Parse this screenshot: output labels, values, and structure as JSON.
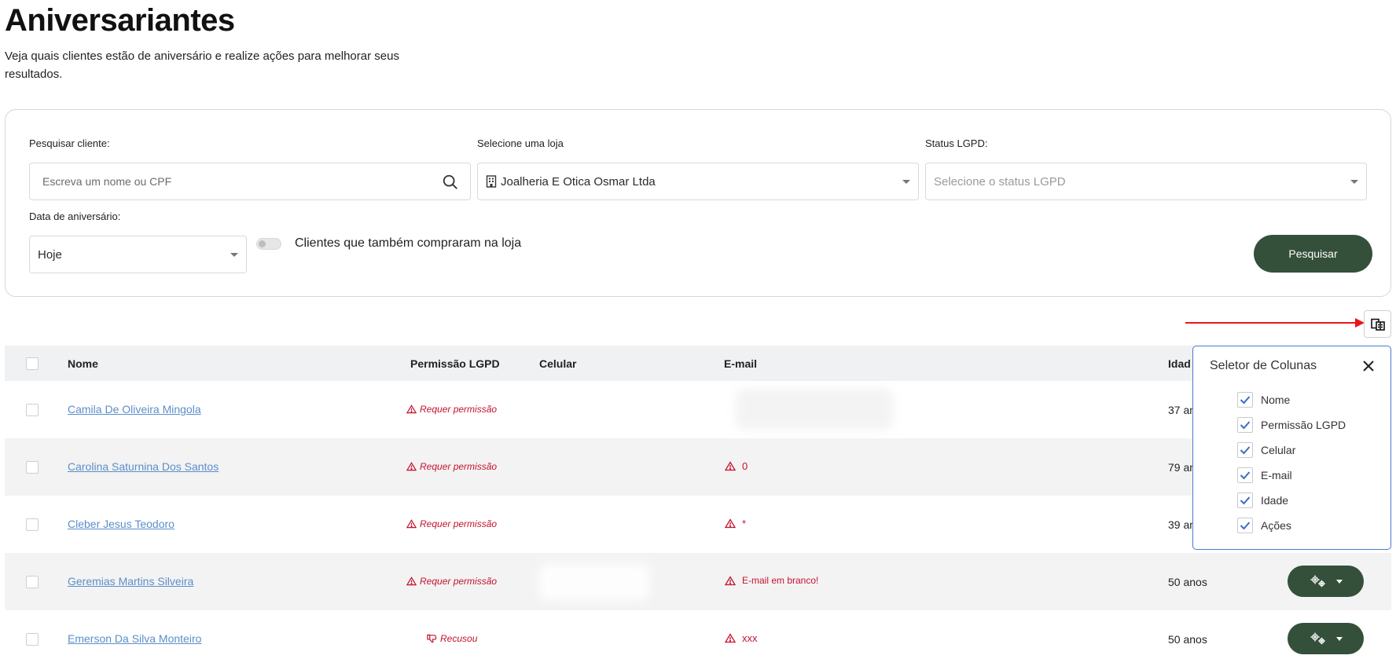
{
  "header": {
    "title": "Aniversariantes",
    "subtitle": "Veja quais clientes estão de aniversário e realize ações para melhorar seus resultados."
  },
  "filters": {
    "search_label": "Pesquisar cliente:",
    "search_placeholder": "Escreva um nome ou CPF",
    "store_label": "Selecione uma loja",
    "store_value": "Joalheria E Otica Osmar Ltda",
    "lgpd_label": "Status LGPD:",
    "lgpd_placeholder": "Selecione o status LGPD",
    "birthday_label": "Data de aniversário:",
    "birthday_value": "Hoje",
    "toggle_label": "Clientes que também compraram na loja",
    "toggle_on": false,
    "search_button": "Pesquisar"
  },
  "table": {
    "headers": {
      "name": "Nome",
      "lgpd": "Permissão LGPD",
      "phone": "Celular",
      "email": "E-mail",
      "age": "Idad"
    },
    "rows": [
      {
        "name": "Camila De Oliveira Mingola",
        "lgpd": "Requer permissão",
        "lgpd_type": "warning",
        "email": "",
        "age": "37 an",
        "actions": false
      },
      {
        "name": "Carolina Saturnina Dos Santos",
        "lgpd": "Requer permissão",
        "lgpd_type": "warning",
        "email": "0",
        "age": "79 an",
        "actions": false
      },
      {
        "name": "Cleber Jesus Teodoro",
        "lgpd": "Requer permissão",
        "lgpd_type": "warning",
        "email": "*",
        "age": "39 an",
        "actions": false
      },
      {
        "name": "Geremias Martins Silveira",
        "lgpd": "Requer permissão",
        "lgpd_type": "warning",
        "email": "E-mail em branco!",
        "age": "50 anos",
        "actions": true
      },
      {
        "name": "Emerson Da Silva Monteiro",
        "lgpd": "Recusou",
        "lgpd_type": "refused",
        "email": "xxx",
        "age": "50 anos",
        "actions": true
      }
    ]
  },
  "column_selector": {
    "title": "Seletor de Colunas",
    "options": [
      {
        "label": "Nome",
        "checked": true
      },
      {
        "label": "Permissão LGPD",
        "checked": true
      },
      {
        "label": "Celular",
        "checked": true
      },
      {
        "label": "E-mail",
        "checked": true
      },
      {
        "label": "Idade",
        "checked": true
      },
      {
        "label": "Ações",
        "checked": true
      }
    ]
  },
  "colors": {
    "primary": "#34503a",
    "link": "#5b8ec9",
    "danger": "#c4122f",
    "annotation_arrow": "#e8161b",
    "panel_border": "#4a7bd0"
  },
  "icons": {
    "search": "search-icon",
    "store": "building-icon",
    "warning": "warning-triangle-icon",
    "refused": "thumbs-down-icon",
    "actions": "gears-icon",
    "column_toggle": "columns-icon",
    "close": "close-icon"
  }
}
